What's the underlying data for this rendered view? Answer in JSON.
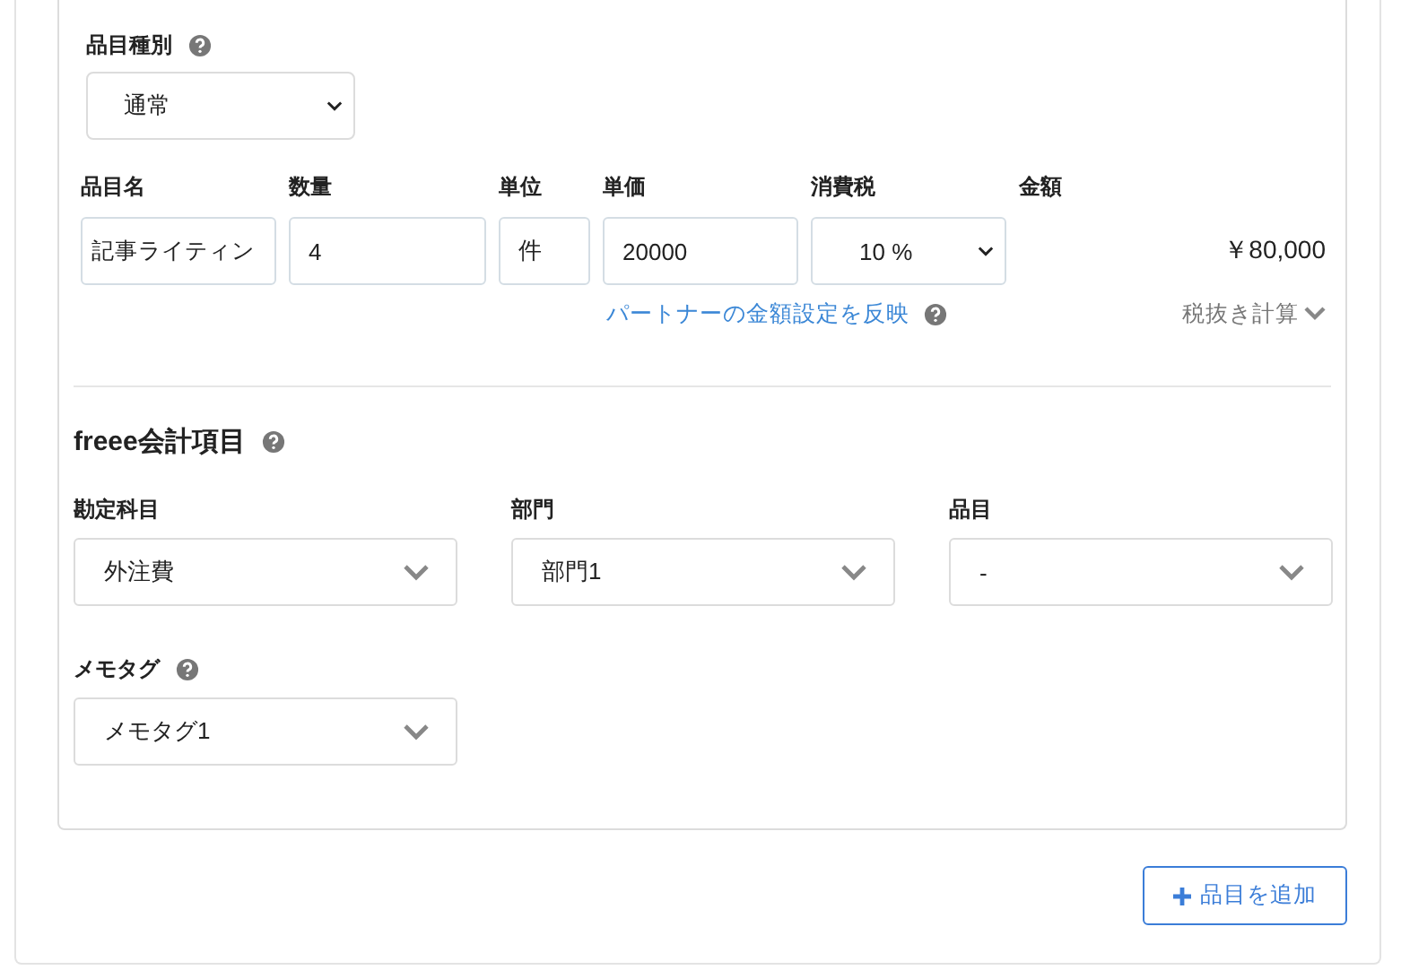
{
  "item_type": {
    "label": "品目種別",
    "help": true,
    "value": "通常"
  },
  "line_fields": [
    {
      "label": "品目名",
      "kind": "input",
      "value": "記事ライティン"
    },
    {
      "label": "数量",
      "kind": "input",
      "value": "4"
    },
    {
      "label": "単位",
      "kind": "input",
      "value": "件"
    },
    {
      "label": "単価",
      "kind": "input",
      "value": "20000"
    },
    {
      "label": "消費税",
      "kind": "select",
      "value": "10 %"
    },
    {
      "label": "金額",
      "kind": "amount",
      "value": "￥80,000"
    }
  ],
  "partner_link": {
    "text": "パートナーの金額設定を反映",
    "help": true
  },
  "tax_mode": "税抜き計算",
  "accounting": {
    "title": "freee会計項目",
    "help": true,
    "fields": [
      {
        "label": "勘定科目",
        "help": false,
        "value": "外注費"
      },
      {
        "label": "部門",
        "help": false,
        "value": "部門1"
      },
      {
        "label": "品目",
        "help": false,
        "value": "-"
      },
      {
        "label": "メモタグ",
        "help": true,
        "value": "メモタグ1"
      }
    ]
  },
  "add_button": "品目を追加"
}
